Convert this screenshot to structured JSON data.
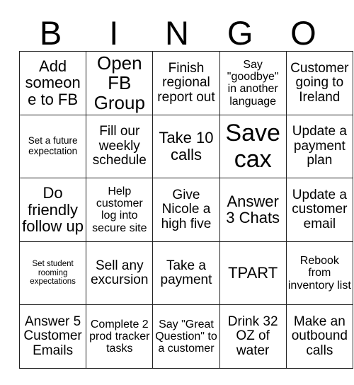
{
  "header": {
    "letters": [
      "B",
      "I",
      "N",
      "G",
      "O"
    ]
  },
  "grid": {
    "rows": [
      [
        {
          "text": "Add someone to FB",
          "size": "lg"
        },
        {
          "text": "Open FB Group",
          "size": "xl"
        },
        {
          "text": "Finish regional report out",
          "size": "md"
        },
        {
          "text": "Say \"goodbye\" in another language",
          "size": "sm"
        },
        {
          "text": "Customer going to Ireland",
          "size": "md"
        }
      ],
      [
        {
          "text": "Set a future expectation",
          "size": "xs"
        },
        {
          "text": "Fill our weekly schedule",
          "size": "md"
        },
        {
          "text": "Take 10 calls",
          "size": "lg"
        },
        {
          "text": "Save cax",
          "size": "xxl"
        },
        {
          "text": "Update a payment plan",
          "size": "md"
        }
      ],
      [
        {
          "text": "Do friendly follow up",
          "size": "lg"
        },
        {
          "text": "Help customer log into secure site",
          "size": "sm"
        },
        {
          "text": "Give Nicole a high five",
          "size": "md"
        },
        {
          "text": "Answer 3 Chats",
          "size": "lg"
        },
        {
          "text": "Update a customer email",
          "size": "md"
        }
      ],
      [
        {
          "text": "Set student rooming expectations",
          "size": "xxs"
        },
        {
          "text": "Sell any excursion",
          "size": "md"
        },
        {
          "text": "Take a payment",
          "size": "md"
        },
        {
          "text": "TPART",
          "size": "lg"
        },
        {
          "text": "Rebook from inventory list",
          "size": "sm"
        }
      ],
      [
        {
          "text": "Answer 5 Customer Emails",
          "size": "md"
        },
        {
          "text": "Complete 2 prod tracker tasks",
          "size": "sm"
        },
        {
          "text": "Say \"Great Question\" to a customer",
          "size": "sm"
        },
        {
          "text": "Drink 32 OZ of water",
          "size": "md"
        },
        {
          "text": "Make an outbound calls",
          "size": "md"
        }
      ]
    ]
  },
  "colors": {
    "background": "#ffffff",
    "border": "#222222",
    "text": "#000000"
  }
}
